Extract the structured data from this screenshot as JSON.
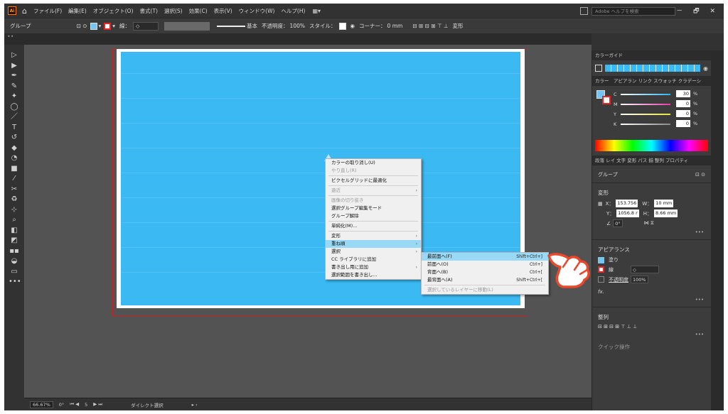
{
  "menubar": {
    "logo": "Ai",
    "items": [
      "ファイル(F)",
      "編集(E)",
      "オブジェクト(O)",
      "書式(T)",
      "選択(S)",
      "効果(C)",
      "表示(V)",
      "ウィンドウ(W)",
      "ヘルプ(H)"
    ],
    "search_placeholder": "Adobe ヘルプを検索",
    "window_controls": "－ 🗗 ✕"
  },
  "controlbar": {
    "selection_label": "グループ",
    "stroke_label": "線：",
    "brush_label": "基本",
    "opacity_label": "不透明度：",
    "opacity_value": "100%",
    "style_label": "スタイル：",
    "corner_label": "コーナー：",
    "corner_value": "0 mm",
    "transform_label": "変形"
  },
  "context_menu": {
    "items": [
      {
        "label": "カラーの取り消し(U)",
        "disabled": false,
        "sep_after": false
      },
      {
        "label": "やり直し(R)",
        "disabled": true,
        "sep_after": true
      },
      {
        "label": "ピクセルグリッドに最適化",
        "disabled": false,
        "sep_after": true
      },
      {
        "label": "遠近",
        "disabled": true,
        "arrow": true,
        "sep_after": true
      },
      {
        "label": "画像の切り抜き",
        "disabled": true,
        "sep_after": false
      },
      {
        "label": "選択グループ編集モード",
        "disabled": false,
        "sep_after": false
      },
      {
        "label": "グループ解除",
        "disabled": false,
        "sep_after": true
      },
      {
        "label": "単純化(M)...",
        "disabled": false,
        "sep_after": true
      },
      {
        "label": "変形",
        "disabled": false,
        "arrow": true,
        "sep_after": false
      },
      {
        "label": "重ね順",
        "disabled": false,
        "arrow": true,
        "highlight": true,
        "sep_after": false
      },
      {
        "label": "選択",
        "disabled": false,
        "arrow": true,
        "sep_after": false
      },
      {
        "label": "CC ライブラリに追加",
        "disabled": false,
        "sep_after": false
      },
      {
        "label": "書き出し用に追加",
        "disabled": false,
        "arrow": true,
        "sep_after": false
      },
      {
        "label": "選択範囲を書き出し...",
        "disabled": false,
        "sep_after": false
      }
    ]
  },
  "submenu": {
    "items": [
      {
        "label": "最前面へ(F)",
        "shortcut": "Shift+Ctrl+]",
        "highlight": true
      },
      {
        "label": "前面へ(O)",
        "shortcut": "Ctrl+]"
      },
      {
        "label": "背面へ(B)",
        "shortcut": "Ctrl+["
      },
      {
        "label": "最背面へ(A)",
        "shortcut": "Shift+Ctrl+["
      },
      {
        "label": "選択しているレイヤーに移動(L)",
        "shortcut": "",
        "disabled": true
      }
    ]
  },
  "panel": {
    "color_guide_title": "カラーガイド",
    "color_tabs": "カラー　アピアラン リンク スウォッチ クラデーシ",
    "cmyk": [
      {
        "label": "C",
        "value": "30",
        "color": "#2ab4f0"
      },
      {
        "label": "M",
        "value": "0",
        "color": "#e43aa7"
      },
      {
        "label": "Y",
        "value": "0",
        "color": "#e8e23a"
      },
      {
        "label": "K",
        "value": "0",
        "color": "#888888"
      }
    ],
    "percent": "%",
    "props_tabs": "段落 レイ 文字 変形 パス 揃 整列 プロパティ",
    "group_label": "グループ",
    "transform_title": "変形",
    "x_label": "X：",
    "x_value": "153.756",
    "w_label": "W：",
    "w_value": "10 mm",
    "y_label": "Y：",
    "y_value": "1056.8 r",
    "h_label": "H：",
    "h_value": "8.66 mm",
    "angle_value": "0°",
    "appearance_title": "アピアランス",
    "fill_label": "塗り",
    "stroke_label": "線",
    "opacity_label": "不透明度",
    "opacity_value": "100%",
    "fx_label": "fx.",
    "align_title": "整列",
    "quick_actions": "クイック操作"
  },
  "statusbar": {
    "zoom": "66.67%",
    "rotation": "0°",
    "page": "5",
    "tool": "ダイレクト選択"
  }
}
